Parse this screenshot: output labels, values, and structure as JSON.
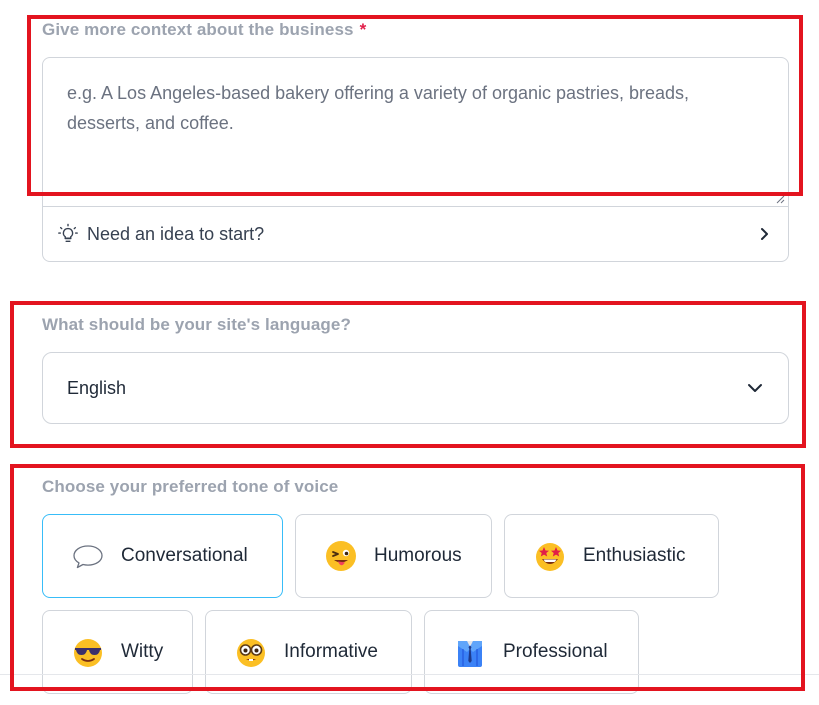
{
  "context": {
    "label": "Give more context about the business",
    "required_mark": "*",
    "placeholder": "e.g. A Los Angeles-based bakery offering a variety of organic pastries, breads, desserts, and coffee.",
    "value": "",
    "idea_text": "Need an idea to start?"
  },
  "language": {
    "label": "What should be your site's language?",
    "selected": "English"
  },
  "tone": {
    "label": "Choose your preferred tone of voice",
    "selected": "Conversational",
    "options": [
      {
        "label": "Conversational",
        "icon": "speech-bubble-icon"
      },
      {
        "label": "Humorous",
        "icon": "winking-tongue-face-icon"
      },
      {
        "label": "Enthusiastic",
        "icon": "star-struck-face-icon"
      },
      {
        "label": "Witty",
        "icon": "sunglasses-face-icon"
      },
      {
        "label": "Informative",
        "icon": "nerd-face-icon"
      },
      {
        "label": "Professional",
        "icon": "suit-tie-icon"
      }
    ]
  },
  "colors": {
    "highlight": "#e3141f",
    "selected_border": "#38bdf8",
    "required": "#e11d48"
  }
}
